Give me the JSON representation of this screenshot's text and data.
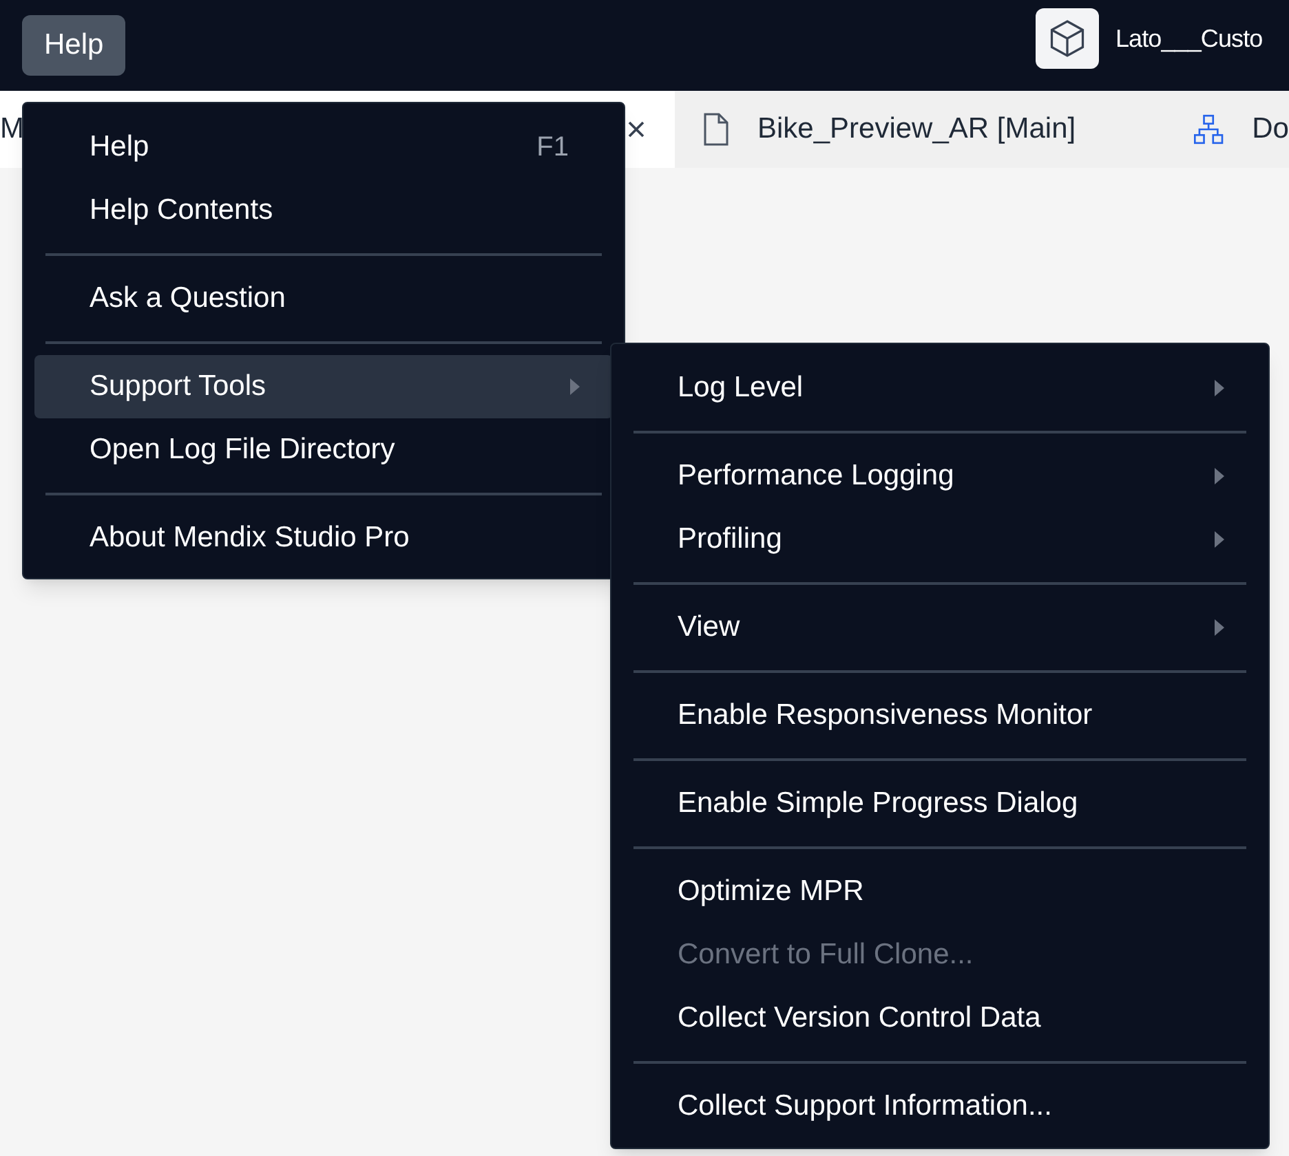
{
  "menubar": {
    "items": [
      {
        "label": "Help",
        "selected": true
      }
    ]
  },
  "project": {
    "title": "Lato___Custo"
  },
  "tabs": [
    {
      "label": "M",
      "selected": true,
      "closable": true
    },
    {
      "label": "Bike_Preview_AR [Main]",
      "kind": "document",
      "selected": false,
      "closable": false
    },
    {
      "label": "Do",
      "kind": "domain-model",
      "selected": false,
      "closable": false
    }
  ],
  "help_menu": {
    "items": [
      {
        "kind": "item",
        "label": "Help",
        "shortcut": "F1",
        "selected": false
      },
      {
        "kind": "item",
        "label": "Help Contents",
        "selected": false
      },
      {
        "kind": "separator"
      },
      {
        "kind": "item",
        "label": "Ask a Question",
        "selected": false
      },
      {
        "kind": "separator"
      },
      {
        "kind": "item",
        "label": "Support Tools",
        "has_submenu": true,
        "selected": true,
        "submenu": {
          "items": [
            {
              "kind": "item",
              "label": "Log Level",
              "has_submenu": true,
              "disabled": false
            },
            {
              "kind": "separator"
            },
            {
              "kind": "item",
              "label": "Performance Logging",
              "has_submenu": true,
              "disabled": false
            },
            {
              "kind": "item",
              "label": "Profiling",
              "has_submenu": true,
              "disabled": false
            },
            {
              "kind": "separator"
            },
            {
              "kind": "item",
              "label": "View",
              "has_submenu": true,
              "disabled": false
            },
            {
              "kind": "separator"
            },
            {
              "kind": "item",
              "label": "Enable Responsiveness Monitor",
              "disabled": false
            },
            {
              "kind": "separator"
            },
            {
              "kind": "item",
              "label": "Enable Simple Progress Dialog",
              "disabled": false
            },
            {
              "kind": "separator"
            },
            {
              "kind": "item",
              "label": "Optimize MPR",
              "disabled": false
            },
            {
              "kind": "item",
              "label": "Convert to Full Clone...",
              "disabled": true
            },
            {
              "kind": "item",
              "label": "Collect Version Control Data",
              "disabled": false
            },
            {
              "kind": "separator"
            },
            {
              "kind": "item",
              "label": "Collect Support Information...",
              "disabled": false
            }
          ]
        }
      },
      {
        "kind": "item",
        "label": "Open Log File Directory",
        "selected": false
      },
      {
        "kind": "separator"
      },
      {
        "kind": "item",
        "label": "About Mendix Studio Pro",
        "selected": false
      }
    ]
  }
}
